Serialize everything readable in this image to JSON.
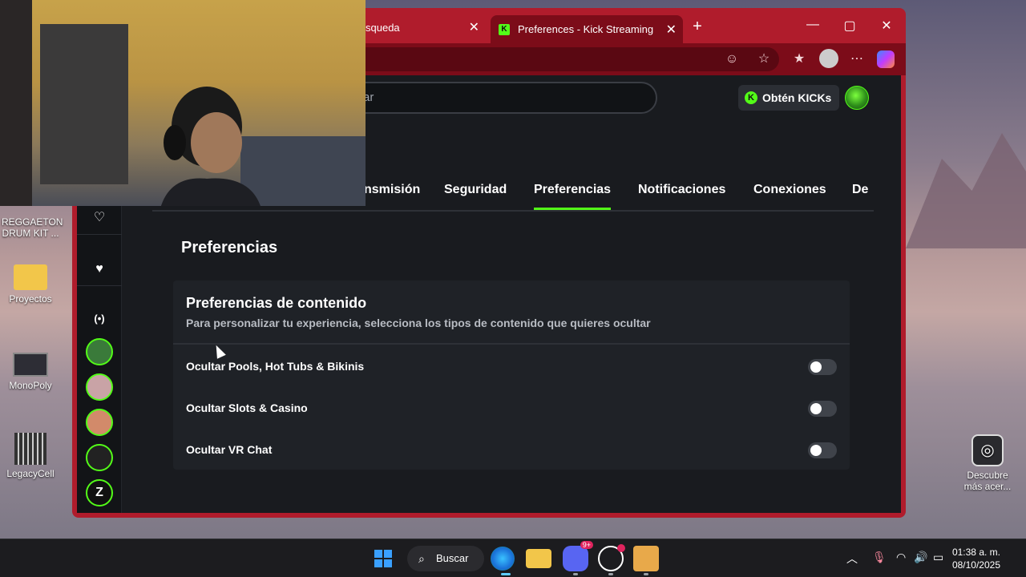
{
  "desktop": {
    "icons": [
      {
        "label": "REGGAETON\nDRUM KIT ...",
        "icon": "audio-file-icon"
      },
      {
        "label": "Proyectos",
        "icon": "folder-icon"
      },
      {
        "label": "MonoPoly",
        "icon": "synth-icon"
      },
      {
        "label": "LegacyCell",
        "icon": "grid-instrument-icon"
      }
    ],
    "discover": {
      "label": "Descubre\nmás acer..."
    }
  },
  "browser": {
    "tabs": [
      {
        "label": "squeda",
        "active": false
      },
      {
        "label": "Preferences - Kick Streaming",
        "active": true
      }
    ],
    "new_tab_label": "+",
    "window_controls": {
      "minimize": "—",
      "maximize": "▢",
      "close": "✕"
    }
  },
  "site": {
    "search_placeholder": "scar",
    "kicks_button": "Obtén KICKs",
    "nav_tabs": [
      {
        "label": "nsmisión",
        "active": false
      },
      {
        "label": "Seguridad",
        "active": false
      },
      {
        "label": "Preferencias",
        "active": true
      },
      {
        "label": "Notificaciones",
        "active": false
      },
      {
        "label": "Conexiones",
        "active": false
      },
      {
        "label": "De",
        "active": false
      }
    ],
    "page_title": "Preferencias",
    "content_prefs": {
      "title": "Preferencias de contenido",
      "subtitle": "Para personalizar tu experiencia, selecciona los tipos de contenido que quieres ocultar",
      "items": [
        {
          "label": "Ocultar Pools, Hot Tubs & Bikinis",
          "enabled": false
        },
        {
          "label": "Ocultar Slots & Casino",
          "enabled": false
        },
        {
          "label": "Ocultar VR Chat",
          "enabled": false
        }
      ]
    }
  },
  "taskbar": {
    "search_label": "Buscar",
    "discord_badge": "9+",
    "clock_time": "01:38 a. m.",
    "clock_date": "08/10/2025"
  },
  "colors": {
    "kick_green": "#53fc18",
    "browser_accent": "#b01c2c",
    "page_bg": "#191b1f"
  }
}
